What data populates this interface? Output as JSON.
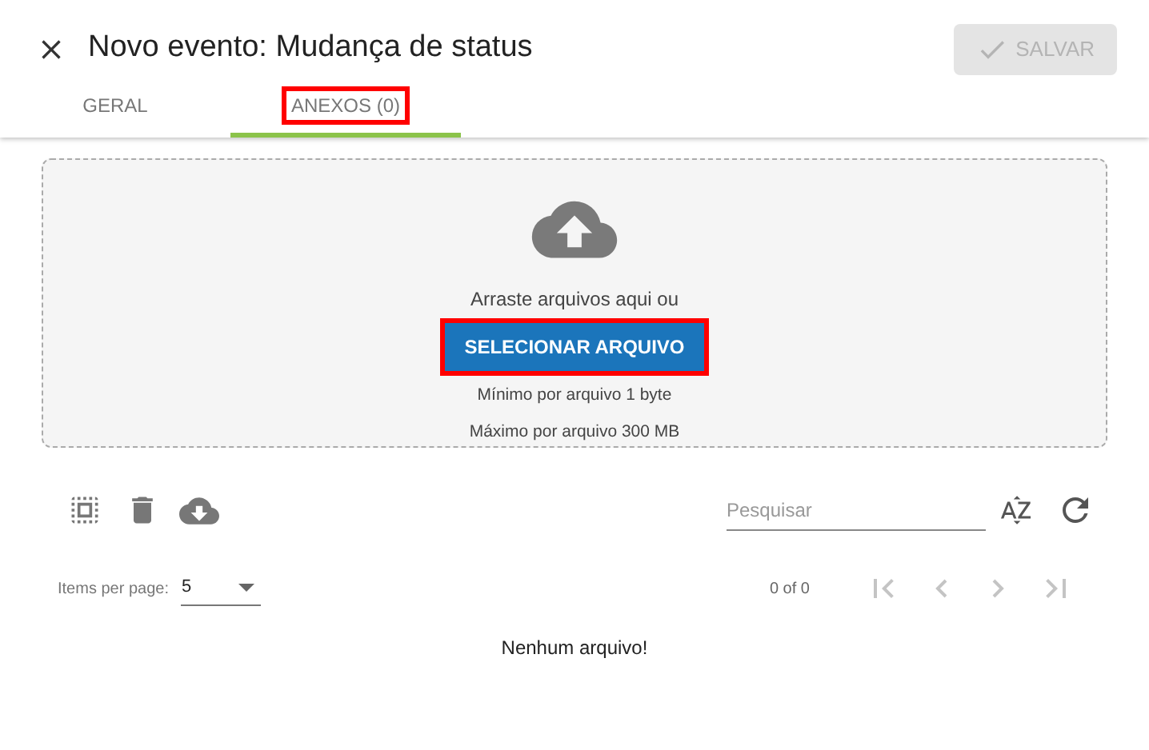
{
  "header": {
    "title": "Novo evento: Mudança de status",
    "save_button": {
      "label": "SALVAR",
      "disabled": true
    }
  },
  "tabs": [
    {
      "label": "GERAL",
      "selected": false,
      "highlighted": false
    },
    {
      "label": "ANEXOS (0)",
      "selected": true,
      "highlighted": true
    }
  ],
  "dropzone": {
    "hint": "Arraste arquivos aqui ou",
    "button": {
      "label": "SELECIONAR ARQUIVO",
      "highlighted": true
    },
    "limits": [
      "Mínimo por arquivo 1 byte",
      "Máximo por arquivo 300 MB"
    ]
  },
  "toolbar": {
    "search": {
      "placeholder": "Pesquisar"
    }
  },
  "paginator": {
    "items_per_page_label": "Items per page:",
    "page_size": "5",
    "range": "0 of 0",
    "disabled": true
  },
  "empty_message": "Nenhum arquivo!"
}
